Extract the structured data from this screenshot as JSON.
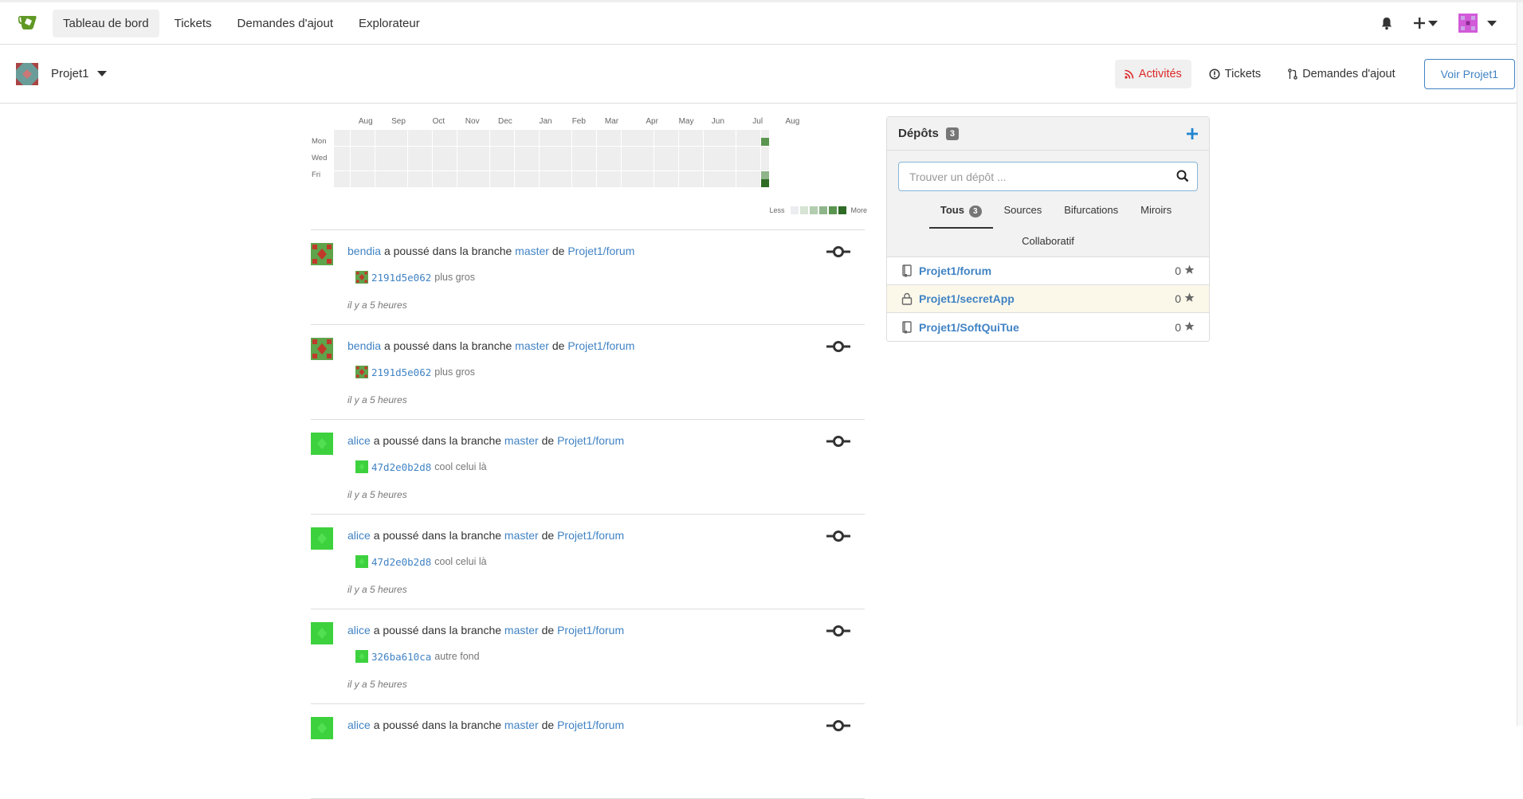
{
  "nav": {
    "items": [
      {
        "label": "Tableau de bord",
        "active": true
      },
      {
        "label": "Tickets",
        "active": false
      },
      {
        "label": "Demandes d'ajout",
        "active": false
      },
      {
        "label": "Explorateur",
        "active": false
      }
    ],
    "icons": [
      "bell-icon",
      "plus-icon",
      "user-avatar"
    ]
  },
  "project": {
    "name": "Projet1",
    "tabs": [
      {
        "label": "Activités",
        "icon": "rss-icon",
        "active": true
      },
      {
        "label": "Tickets",
        "icon": "issue-icon",
        "active": false
      },
      {
        "label": "Demandes d'ajout",
        "icon": "pull-request-icon",
        "active": false
      }
    ],
    "view_button": "Voir Projet1"
  },
  "heatmap": {
    "months": [
      "Aug",
      "Sep",
      "Oct",
      "Nov",
      "Dec",
      "Jan",
      "Feb",
      "Mar",
      "Apr",
      "May",
      "Jun",
      "Jul",
      "Aug"
    ],
    "days": [
      "Mon",
      "Wed",
      "Fri"
    ],
    "legend_less": "Less",
    "legend_more": "More",
    "legend_colors": [
      "#ebedf0",
      "#d6e4d3",
      "#b3cdb0",
      "#8fb58a",
      "#5a9550",
      "#2e6b25"
    ],
    "active_days": [
      {
        "week": 52,
        "day": 1,
        "level": 4
      },
      {
        "week": 52,
        "day": 5,
        "level": 3
      },
      {
        "week": 52,
        "day": 6,
        "level": 5
      }
    ]
  },
  "feed": {
    "verb": "a poussé dans la branche",
    "of": "de",
    "entries": [
      {
        "user": "bendia",
        "branch": "master",
        "repo": "Projet1/forum",
        "sha": "2191d5e062",
        "message": "plus gros",
        "time": "il y a 5 heures",
        "avatar": "red"
      },
      {
        "user": "bendia",
        "branch": "master",
        "repo": "Projet1/forum",
        "sha": "2191d5e062",
        "message": "plus gros",
        "time": "il y a 5 heures",
        "avatar": "red"
      },
      {
        "user": "alice",
        "branch": "master",
        "repo": "Projet1/forum",
        "sha": "47d2e0b2d8",
        "message": "cool celui là",
        "time": "il y a 5 heures",
        "avatar": "green"
      },
      {
        "user": "alice",
        "branch": "master",
        "repo": "Projet1/forum",
        "sha": "47d2e0b2d8",
        "message": "cool celui là",
        "time": "il y a 5 heures",
        "avatar": "green"
      },
      {
        "user": "alice",
        "branch": "master",
        "repo": "Projet1/forum",
        "sha": "326ba610ca",
        "message": "autre fond",
        "time": "il y a 5 heures",
        "avatar": "green"
      },
      {
        "user": "alice",
        "branch": "master",
        "repo": "Projet1/forum",
        "sha": "",
        "message": "",
        "time": "",
        "avatar": "green"
      }
    ]
  },
  "repos": {
    "title": "Dépôts",
    "count": "3",
    "search_placeholder": "Trouver un dépôt ...",
    "tabs": [
      {
        "label": "Tous",
        "count": "3",
        "active": true
      },
      {
        "label": "Sources"
      },
      {
        "label": "Bifurcations"
      },
      {
        "label": "Miroirs"
      }
    ],
    "collab_tab": "Collaboratif",
    "list": [
      {
        "name": "Projet1/forum",
        "stars": "0",
        "private": false
      },
      {
        "name": "Projet1/secretApp",
        "stars": "0",
        "private": true
      },
      {
        "name": "Projet1/SoftQuiTue",
        "stars": "0",
        "private": false
      }
    ]
  }
}
